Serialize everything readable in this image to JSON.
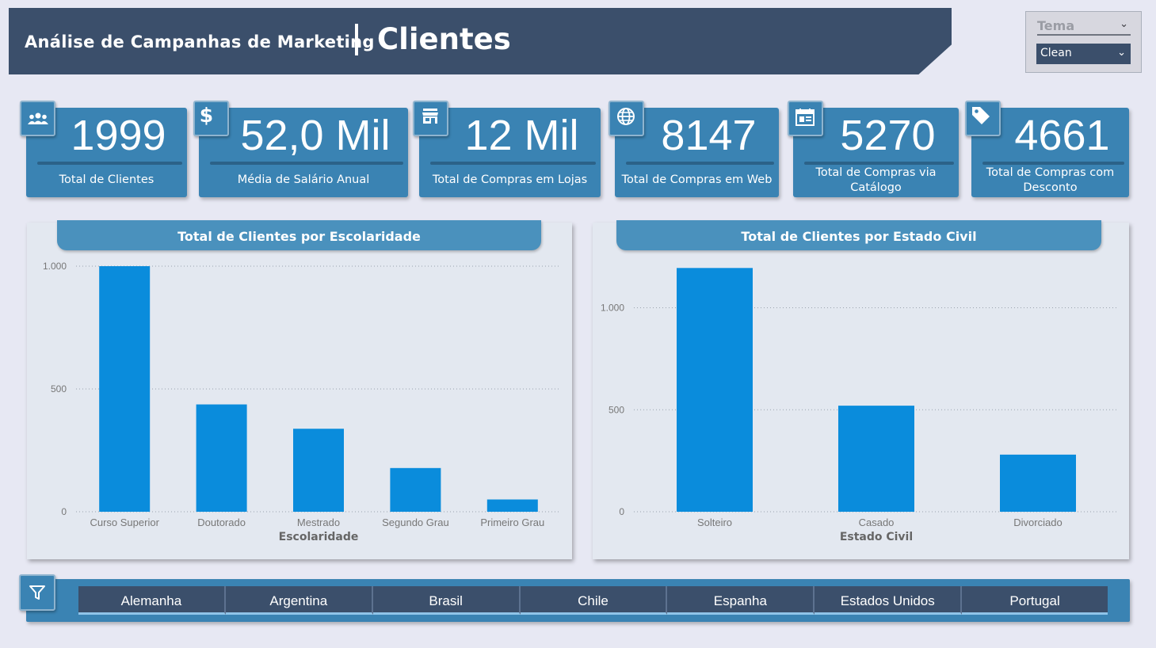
{
  "header": {
    "app_title": "Análise de Campanhas de Marketing",
    "page_title": "Clientes"
  },
  "theme": {
    "label": "Tema",
    "selected": "Clean"
  },
  "kpis": [
    {
      "value": "1999",
      "label": "Total de Clientes",
      "icon": "people-icon"
    },
    {
      "value": "52,0 Mil",
      "label": "Média de Salário Anual",
      "icon": "dollar-icon"
    },
    {
      "value": "12 Mil",
      "label": "Total de Compras em Lojas",
      "icon": "store-icon"
    },
    {
      "value": "8147",
      "label": "Total de Compras em Web",
      "icon": "globe-icon"
    },
    {
      "value": "5270",
      "label": "Total de Compras via Catálogo",
      "icon": "catalog-icon"
    },
    {
      "value": "4661",
      "label": "Total de Compras com Desconto",
      "icon": "tag-icon"
    }
  ],
  "filter": {
    "icon": "filter-icon",
    "countries": [
      "Alemanha",
      "Argentina",
      "Brasil",
      "Chile",
      "Espanha",
      "Estados Unidos",
      "Portugal"
    ]
  },
  "colors": {
    "header": "#3b4f6b",
    "card": "#3a83b3",
    "bar": "#0a8cdc",
    "panel": "#e3e8f0"
  },
  "chart_data": [
    {
      "type": "bar",
      "title": "Total de Clientes por Escolaridade",
      "xlabel": "Escolaridade",
      "ylabel": "",
      "categories": [
        "Curso Superior",
        "Doutorado",
        "Mestrado",
        "Segundo Grau",
        "Primeiro Grau"
      ],
      "values": [
        1000,
        437,
        338,
        178,
        50
      ],
      "ylim": [
        0,
        1000
      ],
      "yticks": [
        {
          "v": 0,
          "t": "0"
        },
        {
          "v": 500,
          "t": "500"
        },
        {
          "v": 1000,
          "t": "1.000"
        }
      ],
      "grid": true
    },
    {
      "type": "bar",
      "title": "Total de Clientes por Estado Civil",
      "xlabel": "Estado Civil",
      "ylabel": "",
      "categories": [
        "Solteiro",
        "Casado",
        "Divorciado"
      ],
      "values": [
        1195,
        520,
        280
      ],
      "ylim": [
        0,
        1200
      ],
      "yticks": [
        {
          "v": 0,
          "t": "0"
        },
        {
          "v": 500,
          "t": "500"
        },
        {
          "v": 1000,
          "t": "1.000"
        }
      ],
      "grid": true
    }
  ]
}
